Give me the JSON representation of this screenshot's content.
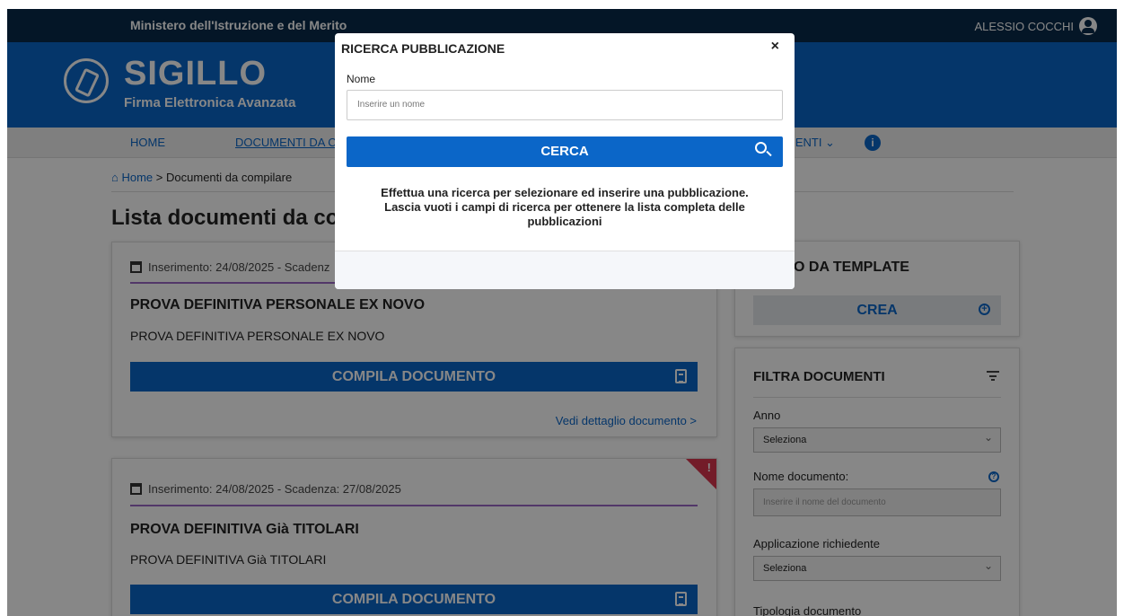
{
  "topbar": {
    "ministry": "Ministero dell'Istruzione e del Merito",
    "user_name": "ALESSIO COCCHI"
  },
  "brand": {
    "name": "SIGILLO",
    "subtitle": "Firma Elettronica Avanzata"
  },
  "nav": {
    "home": "HOME",
    "documenti": "DOCUMENTI DA C",
    "more": "MENTI ⌄",
    "info": "i"
  },
  "breadcrumb": {
    "home": "Home",
    "separator": ">",
    "current": "Documenti da compilare"
  },
  "page": {
    "title": "Lista documenti da com"
  },
  "cards": [
    {
      "meta": "Inserimento: 24/08/2025 - Scadenz",
      "title": "PROVA DEFINITIVA PERSONALE EX NOVO",
      "subtitle": "PROVA DEFINITIVA PERSONALE EX NOVO",
      "button": "COMPILA DOCUMENTO",
      "detail_link": "Vedi dettaglio documento  >"
    },
    {
      "meta": "Inserimento: 24/08/2025 - Scadenza: 27/08/2025",
      "title": "PROVA DEFINITIVA Già TITOLARI",
      "subtitle": "PROVA DEFINITIVA Già TITOLARI",
      "button": "COMPILA DOCUMENTO",
      "alert": "!"
    }
  ],
  "sidebar": {
    "template_heading": "MENTO DA TEMPLATE",
    "crea": "CREA",
    "filter_heading": "FILTRA DOCUMENTI",
    "anno_label": "Anno",
    "anno_value": "Seleziona",
    "nome_label": "Nome documento:",
    "nome_placeholder": "Inserire il nome del documento",
    "app_label": "Applicazione richiedente",
    "app_value": "Seleziona",
    "tipologia_label": "Tipologia documento"
  },
  "modal": {
    "title": "RICERCA PUBBLICAZIONE",
    "close": "×",
    "field_label": "Nome",
    "field_placeholder": "Inserire un nome",
    "search_button": "CERCA",
    "message": "Effettua una ricerca per selezionare ed inserire una pubblicazione. Lascia vuoti i campi di ricerca per ottenere la lista completa delle pubblicazioni"
  }
}
